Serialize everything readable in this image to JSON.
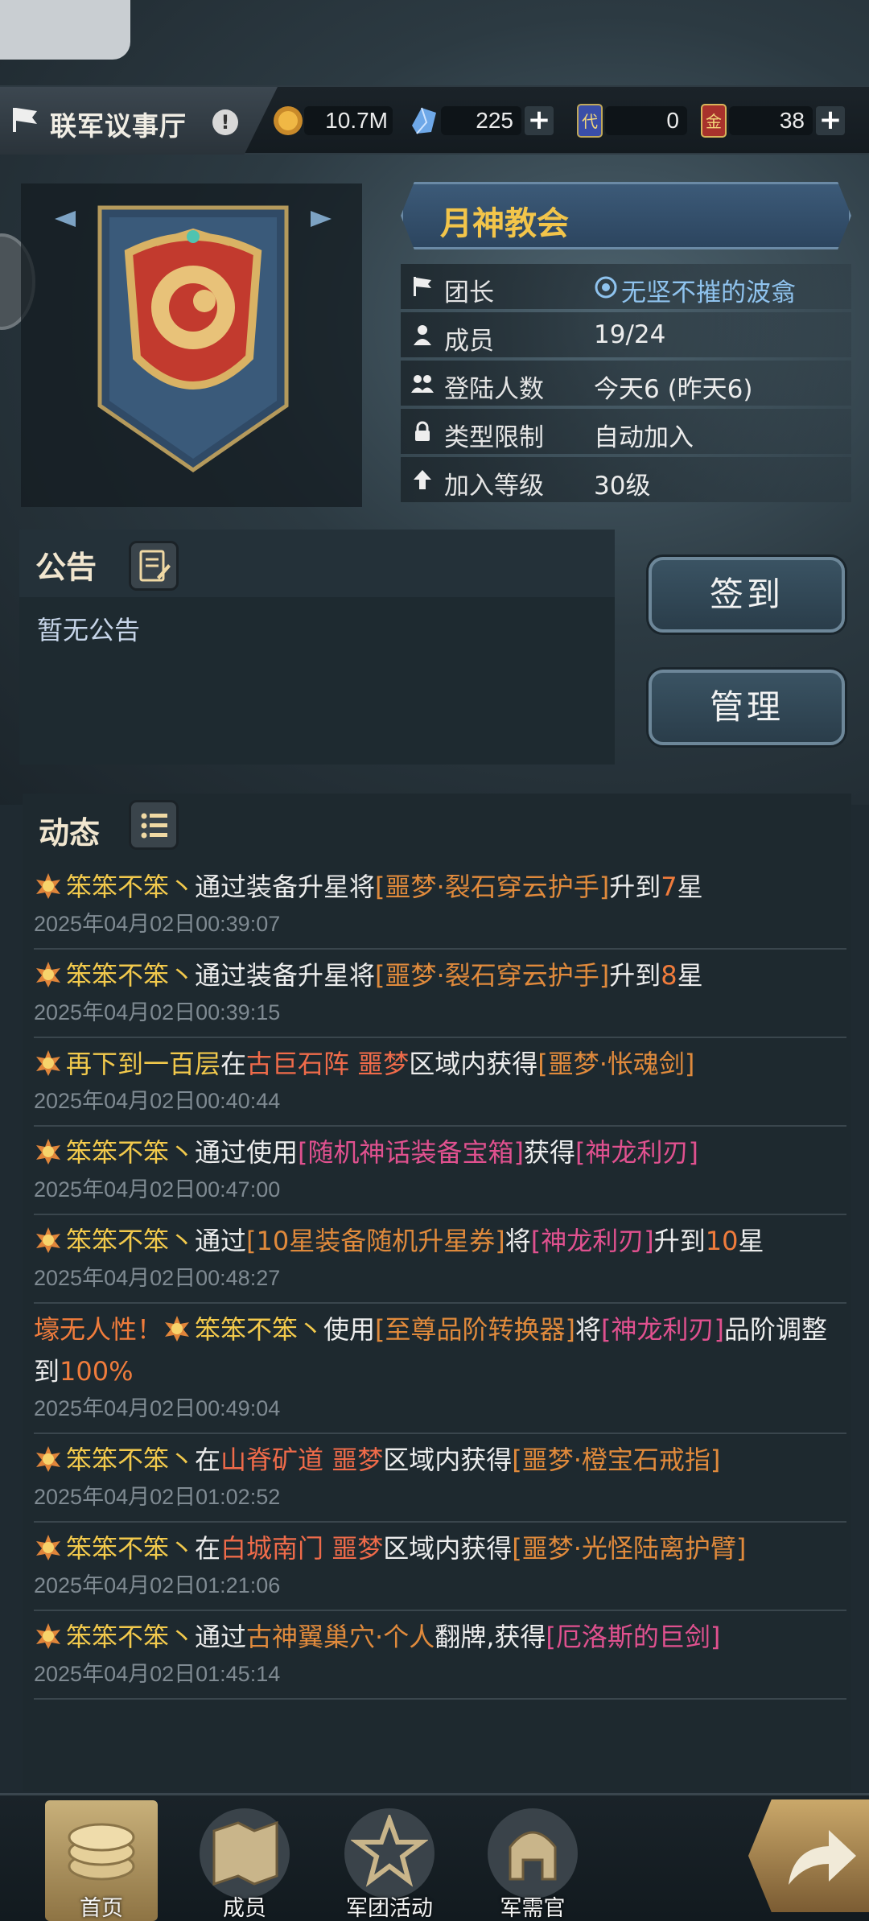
{
  "header": {
    "title": "联军议事厅",
    "alert_symbol": "!",
    "resources": {
      "gold": "10.7M",
      "crystal": "225",
      "token": "0",
      "card": "38"
    }
  },
  "guild": {
    "name": "月神教会",
    "rows": [
      {
        "label": "团长",
        "value": "无坚不摧的波翕",
        "icon": "flag-icon"
      },
      {
        "label": "成员",
        "value": "19/24",
        "icon": "person-icon"
      },
      {
        "label": "登陆人数",
        "value": "今天6 (昨天6)",
        "icon": "group-icon"
      },
      {
        "label": "类型限制",
        "value": "自动加入",
        "icon": "lock-icon"
      },
      {
        "label": "加入等级",
        "value": "30级",
        "icon": "level-up-icon"
      }
    ]
  },
  "notice": {
    "title": "公告",
    "text": "暂无公告"
  },
  "buttons": {
    "checkin": "签到",
    "manage": "管理"
  },
  "feed": {
    "title": "动态",
    "items": [
      {
        "time": "2025年04月02日00:39:07",
        "parts": [
          {
            "t": "笨笨不笨丶",
            "c": "y"
          },
          {
            "t": "通过装备升星将",
            "c": ""
          },
          {
            "t": "[噩梦·裂石穿云护手]",
            "c": "o"
          },
          {
            "t": "升到",
            "c": ""
          },
          {
            "t": "7",
            "c": "hl"
          },
          {
            "t": "星",
            "c": ""
          }
        ]
      },
      {
        "time": "2025年04月02日00:39:15",
        "parts": [
          {
            "t": "笨笨不笨丶",
            "c": "y"
          },
          {
            "t": "通过装备升星将",
            "c": ""
          },
          {
            "t": "[噩梦·裂石穿云护手]",
            "c": "o"
          },
          {
            "t": "升到",
            "c": ""
          },
          {
            "t": "8",
            "c": "hl"
          },
          {
            "t": "星",
            "c": ""
          }
        ]
      },
      {
        "time": "2025年04月02日00:40:44",
        "parts": [
          {
            "t": "再下到一百层",
            "c": "y"
          },
          {
            "t": "在",
            "c": ""
          },
          {
            "t": "古巨石阵 噩梦",
            "c": "r"
          },
          {
            "t": "区域内获得",
            "c": ""
          },
          {
            "t": "[噩梦·怅魂剑]",
            "c": "o"
          }
        ]
      },
      {
        "time": "2025年04月02日00:47:00",
        "parts": [
          {
            "t": "笨笨不笨丶",
            "c": "y"
          },
          {
            "t": "通过使用",
            "c": ""
          },
          {
            "t": "[随机神话装备宝箱]",
            "c": "p"
          },
          {
            "t": "获得",
            "c": ""
          },
          {
            "t": "[神龙利刃]",
            "c": "p"
          }
        ]
      },
      {
        "time": "2025年04月02日00:48:27",
        "parts": [
          {
            "t": "笨笨不笨丶",
            "c": "y"
          },
          {
            "t": "通过",
            "c": ""
          },
          {
            "t": "[10星装备随机升星券]",
            "c": "o"
          },
          {
            "t": "将",
            "c": ""
          },
          {
            "t": "[神龙利刃]",
            "c": "p"
          },
          {
            "t": "升到",
            "c": ""
          },
          {
            "t": "10",
            "c": "hl"
          },
          {
            "t": "星",
            "c": ""
          }
        ]
      },
      {
        "time": "2025年04月02日00:49:04",
        "parts": [
          {
            "t": "壕无人性！",
            "c": "hl"
          },
          {
            "t": "笨笨不笨丶",
            "c": "y"
          },
          {
            "t": "使用",
            "c": ""
          },
          {
            "t": "[至尊品阶转换器]",
            "c": "o"
          },
          {
            "t": "将",
            "c": ""
          },
          {
            "t": "[神龙利刃]",
            "c": "p"
          },
          {
            "t": "品阶调整到",
            "c": ""
          },
          {
            "t": "100%",
            "c": "hl"
          }
        ]
      },
      {
        "time": "2025年04月02日01:02:52",
        "parts": [
          {
            "t": "笨笨不笨丶",
            "c": "y"
          },
          {
            "t": "在",
            "c": ""
          },
          {
            "t": "山脊矿道 噩梦",
            "c": "r"
          },
          {
            "t": "区域内获得",
            "c": ""
          },
          {
            "t": "[噩梦·橙宝石戒指]",
            "c": "o"
          }
        ]
      },
      {
        "time": "2025年04月02日01:21:06",
        "parts": [
          {
            "t": "笨笨不笨丶",
            "c": "y"
          },
          {
            "t": "在",
            "c": ""
          },
          {
            "t": "白城南门 噩梦",
            "c": "r"
          },
          {
            "t": "区域内获得",
            "c": ""
          },
          {
            "t": "[噩梦·光怪陆离护臂]",
            "c": "o"
          }
        ]
      },
      {
        "time": "2025年04月02日01:45:14",
        "parts": [
          {
            "t": "笨笨不笨丶",
            "c": "y"
          },
          {
            "t": "通过",
            "c": ""
          },
          {
            "t": "古神翼巢穴·个人",
            "c": "o"
          },
          {
            "t": "翻牌,获得",
            "c": ""
          },
          {
            "t": "[厄洛斯的巨剑]",
            "c": "p"
          }
        ]
      }
    ]
  },
  "nav": {
    "items": [
      "首页",
      "成员",
      "军团活动",
      "军需官"
    ]
  },
  "colors": {
    "gold_text": "#f2c94c",
    "orange_item": "#e08a3c",
    "pink_item": "#e0518f"
  }
}
